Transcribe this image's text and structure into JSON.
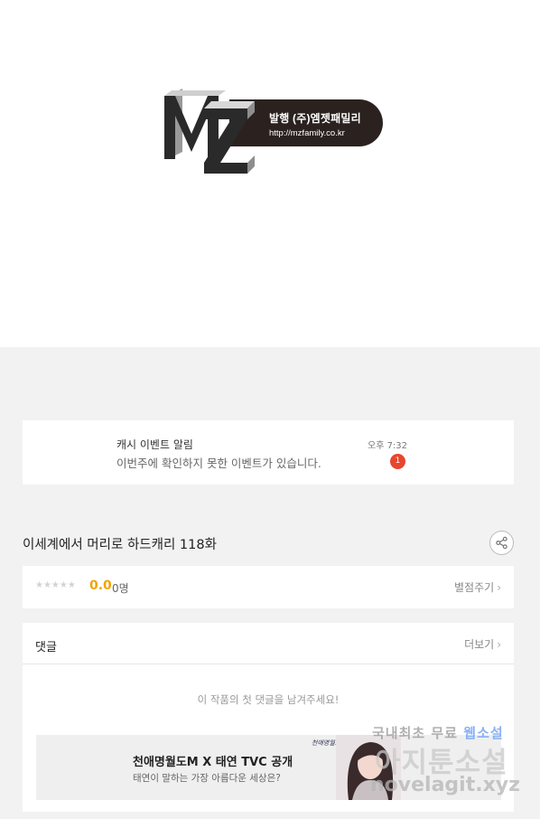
{
  "publisher": {
    "logo_letters": "MZ",
    "name_line": "발행 (주)엠젯패밀리",
    "url_line": "http://mzfamily.co.kr"
  },
  "event_notice": {
    "title": "캐시 이벤트 알림",
    "time": "오후 7:32",
    "message": "이번주에 확인하지 못한 이벤트가 있습니다.",
    "badge_count": "1"
  },
  "episode": {
    "title": "이세계에서 머리로 하드캐리 118화"
  },
  "rating": {
    "stars": "★★★★★",
    "score": "0.0",
    "people": "0명",
    "rate_label": "별점주기",
    "chevron": "›"
  },
  "comments": {
    "title": "댓글",
    "more_label": "더보기",
    "chevron": "›",
    "empty_text": "이 작품의 첫 댓글을 남겨주세요!"
  },
  "ad": {
    "title": "천애명월도M X 태연 TVC 공개",
    "subtitle": "태연이 말하는 가장 아름다운 세상은?",
    "logo_text": "천애명월도M"
  },
  "watermark": {
    "line1": "국내최초 무료",
    "line1_highlight": "웹소설",
    "line2": "아지툰소설",
    "line3": "novelagit.xyz"
  },
  "colors": {
    "accent_score": "#f0a400",
    "badge": "#e8452d",
    "background": "#f2f2f2"
  },
  "icons": [
    "share-icon",
    "chevron-right-icon",
    "star-icon"
  ]
}
